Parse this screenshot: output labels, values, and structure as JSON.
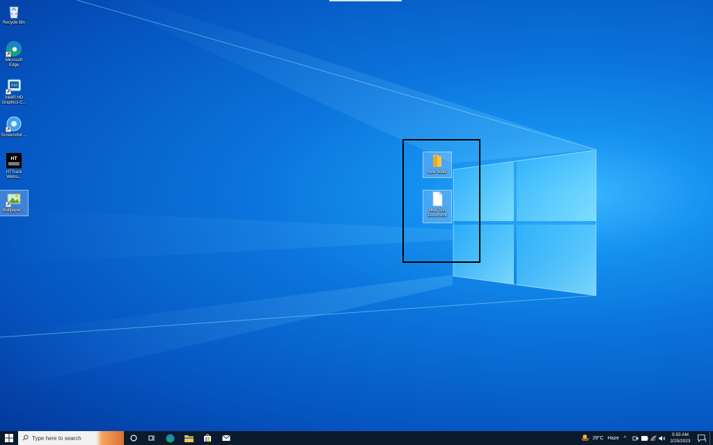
{
  "desktop": {
    "icons": [
      {
        "label": "Recycle Bin",
        "icon": "recycle-bin-icon"
      },
      {
        "label": "Microsoft Edge",
        "icon": "edge-icon"
      },
      {
        "label": "Intel® HD Graphics C...",
        "icon": "intel-graphics-icon"
      },
      {
        "label": "Screenshot ...",
        "icon": "screenshot-icon"
      },
      {
        "label": "HTTrack Websi...",
        "icon": "httrack-icon"
      },
      {
        "label": "Wallpaper ...",
        "icon": "wallpaper-icon"
      }
    ],
    "selected_items": [
      {
        "label": "New folder",
        "icon": "folder-icon"
      },
      {
        "label": "New Text Document",
        "icon": "text-document-icon"
      }
    ]
  },
  "taskbar": {
    "search_placeholder": "Type here to search",
    "pinned": [
      "task-view-icon",
      "edge-icon",
      "file-explorer-icon",
      "store-icon",
      "mail-icon"
    ],
    "weather": {
      "temp": "29°C",
      "condition": "Haze"
    },
    "clock": {
      "time": "5:55 AM",
      "date": "2/25/2023"
    },
    "notification_count": "1"
  },
  "colors": {
    "taskbar": "#0b1a2c",
    "wallpaper_accent": "#1591f0",
    "selection_border": "#000000"
  }
}
